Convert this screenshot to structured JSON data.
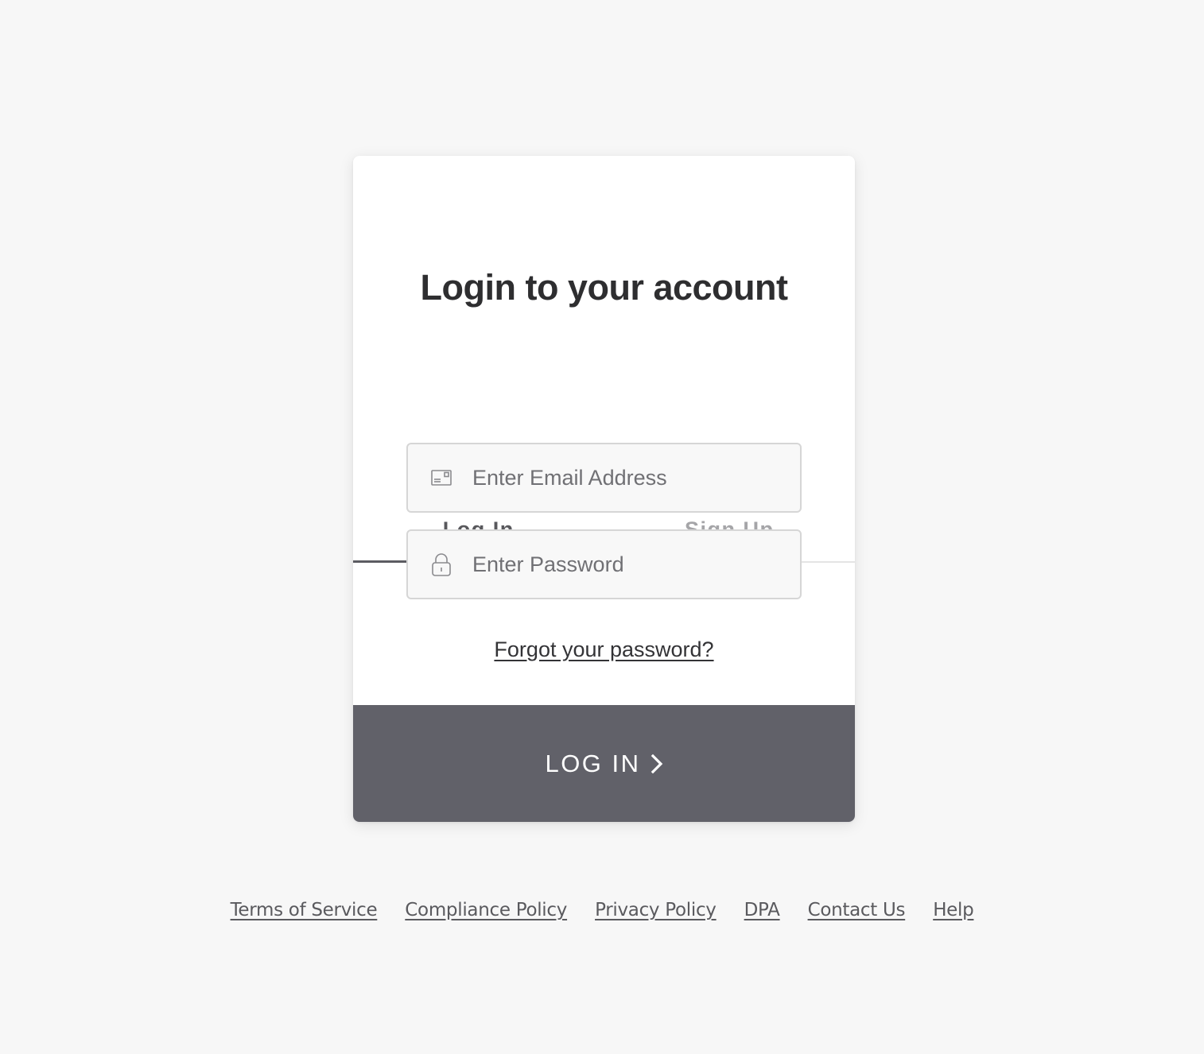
{
  "card": {
    "title": "Login to your account",
    "tabs": [
      {
        "label": "Log In",
        "active": true
      },
      {
        "label": "Sign Up",
        "active": false
      }
    ],
    "email": {
      "placeholder": "Enter Email Address",
      "value": "",
      "icon": "envelope-card-icon"
    },
    "password": {
      "placeholder": "Enter Password",
      "value": "",
      "icon": "padlock-icon"
    },
    "forgot_link": "Forgot your password?",
    "submit": {
      "label": "LOG IN",
      "icon": "chevron-right-icon",
      "color": "#616169"
    }
  },
  "footer": {
    "links": [
      {
        "label": "Terms of Service"
      },
      {
        "label": "Compliance Policy"
      },
      {
        "label": "Privacy Policy"
      },
      {
        "label": "DPA"
      },
      {
        "label": "Contact Us"
      },
      {
        "label": "Help"
      }
    ]
  },
  "colors": {
    "background": "#f7f7f7",
    "card": "#ffffff",
    "active_tab_underline": "#5c5c62",
    "button": "#616169"
  }
}
